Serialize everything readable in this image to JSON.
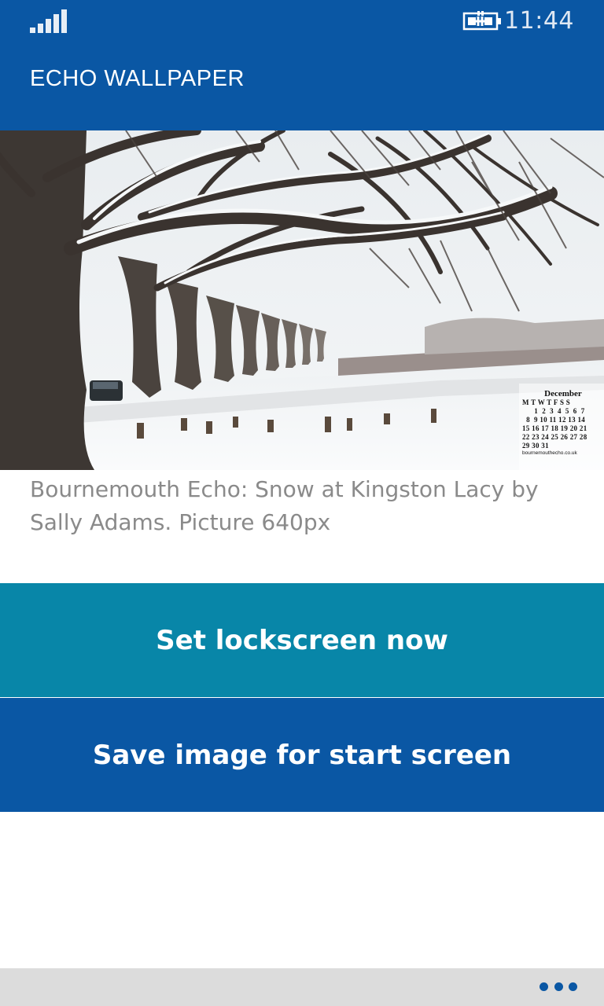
{
  "status_bar": {
    "time": "11:44",
    "signal_icon": "signal-strength-icon",
    "battery_icon": "battery-charging-icon"
  },
  "header": {
    "title": "ECHO WALLPAPER",
    "background_color": "#0a57a4"
  },
  "wallpaper": {
    "calendar": {
      "month": "December",
      "weekday_header": "M T W T F S S",
      "rows": [
        "      1  2  3  4  5  6  7",
        "  8  9 10 11 12 13 14",
        "15 16 17 18 19 20 21",
        "22 23 24 25 26 27 28",
        "29 30 31"
      ],
      "site": "bournemouthecho.co.uk"
    }
  },
  "caption": "Bournemouth Echo: Snow at Kingston Lacy by Sally Adams. Picture 640px",
  "buttons": {
    "lockscreen_label": "Set lockscreen now",
    "lockscreen_color": "#0886a8",
    "save_label": "Save image for start screen",
    "save_color": "#0a57a4"
  },
  "app_bar": {
    "more_icon": "ellipsis-icon"
  }
}
